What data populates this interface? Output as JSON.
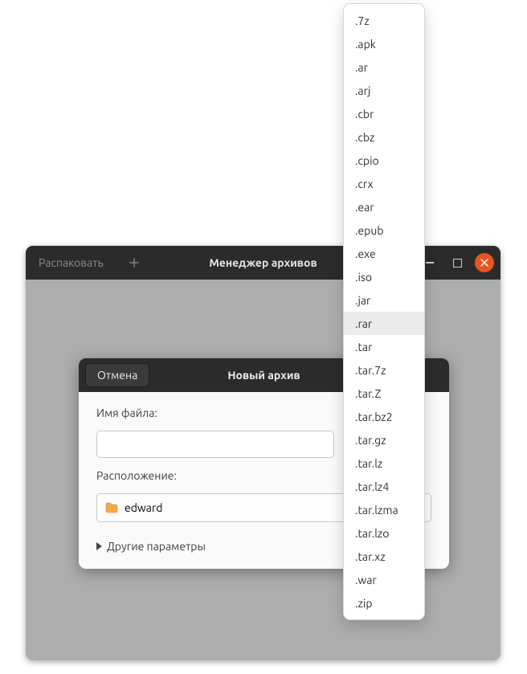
{
  "window": {
    "extract_label": "Распаковать",
    "title": "Менеджер архивов"
  },
  "dialog": {
    "cancel_label": "Отмена",
    "title": "Новый архив",
    "filename_label": "Имя файла:",
    "filename_value": "",
    "location_label": "Расположение:",
    "location_value": "edward",
    "other_params_label": "Другие параметры"
  },
  "dropdown": {
    "hover_index": 13,
    "items": [
      ".7z",
      ".apk",
      ".ar",
      ".arj",
      ".cbr",
      ".cbz",
      ".cpio",
      ".crx",
      ".ear",
      ".epub",
      ".exe",
      ".iso",
      ".jar",
      ".rar",
      ".tar",
      ".tar.7z",
      ".tar.Z",
      ".tar.bz2",
      ".tar.gz",
      ".tar.lz",
      ".tar.lz4",
      ".tar.lzma",
      ".tar.lzo",
      ".tar.xz",
      ".war",
      ".zip"
    ]
  }
}
